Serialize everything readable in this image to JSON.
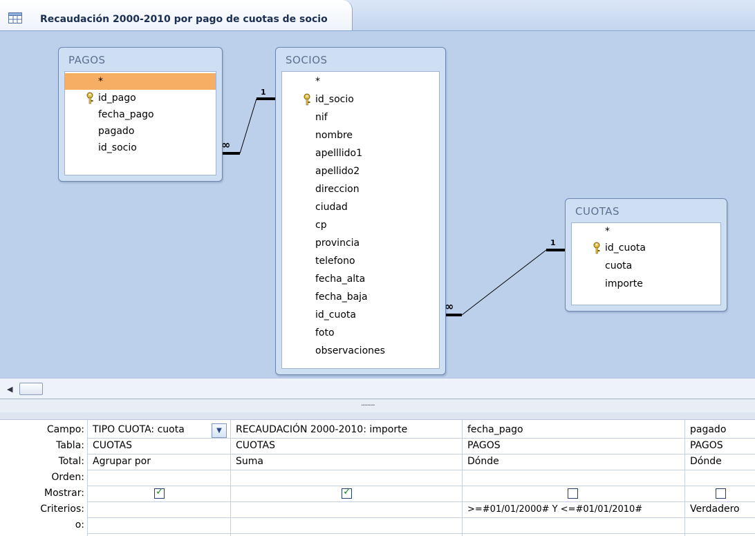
{
  "window": {
    "title": "Recaudación 2000-2010 por pago de cuotas de socio",
    "icon": "query-icon"
  },
  "tables": {
    "pagos": {
      "title": "PAGOS",
      "fields": [
        "*",
        "id_pago",
        "fecha_pago",
        "pagado",
        "id_socio"
      ],
      "key": "id_pago",
      "selected": "*"
    },
    "socios": {
      "title": "SOCIOS",
      "fields": [
        "*",
        "id_socio",
        "nif",
        "nombre",
        "apelllido1",
        "apellido2",
        "direccion",
        "ciudad",
        "cp",
        "provincia",
        "telefono",
        "fecha_alta",
        "fecha_baja",
        "id_cuota",
        "foto",
        "observaciones"
      ],
      "key": "id_socio"
    },
    "cuotas": {
      "title": "CUOTAS",
      "fields": [
        "*",
        "id_cuota",
        "cuota",
        "importe"
      ],
      "key": "id_cuota"
    }
  },
  "relationships": [
    {
      "from": "PAGOS.id_socio",
      "to": "SOCIOS.id_socio",
      "many_label": "∞",
      "one_label": "1"
    },
    {
      "from": "SOCIOS.id_cuota",
      "to": "CUOTAS.id_cuota",
      "many_label": "∞",
      "one_label": "1"
    }
  ],
  "grid": {
    "row_labels": [
      "Campo:",
      "Tabla:",
      "Total:",
      "Orden:",
      "Mostrar:",
      "Criterios:",
      "o:"
    ],
    "columns": [
      {
        "campo": "TIPO CUOTA: cuota",
        "tabla": "CUOTAS",
        "total": "Agrupar por",
        "orden": "",
        "mostrar": true,
        "criterios": "",
        "o": ""
      },
      {
        "campo": "RECAUDACIÓN 2000-2010: importe",
        "tabla": "CUOTAS",
        "total": "Suma",
        "orden": "",
        "mostrar": true,
        "criterios": "",
        "o": ""
      },
      {
        "campo": "fecha_pago",
        "tabla": "PAGOS",
        "total": "Dónde",
        "orden": "",
        "mostrar": false,
        "criterios": ">=#01/01/2000# Y <=#01/01/2010#",
        "o": ""
      },
      {
        "campo": "pagado",
        "tabla": "PAGOS",
        "total": "Dónde",
        "orden": "",
        "mostrar": false,
        "criterios": "Verdadero",
        "o": ""
      }
    ]
  },
  "colors": {
    "canvas": "#bcd0ec",
    "selected_field": "#f5ae64",
    "title_text": "#1b2f52"
  }
}
